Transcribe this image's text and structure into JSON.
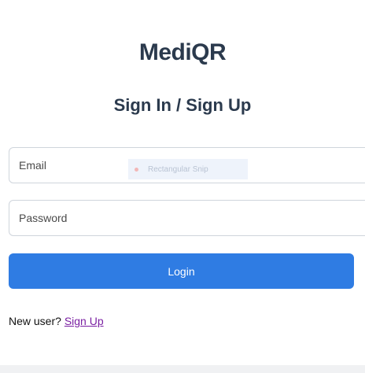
{
  "app": {
    "title": "MediQR",
    "heading": "Sign In / Sign Up"
  },
  "form": {
    "email_placeholder": "Email",
    "password_placeholder": "Password",
    "login_label": "Login"
  },
  "signup": {
    "prompt": "New user?",
    "link_label": "Sign Up"
  },
  "overlay": {
    "snip_label": "Rectangular Snip"
  },
  "colors": {
    "primary": "#2f7ce3",
    "heading": "#2b3a4d",
    "link": "#7a1fa2"
  }
}
